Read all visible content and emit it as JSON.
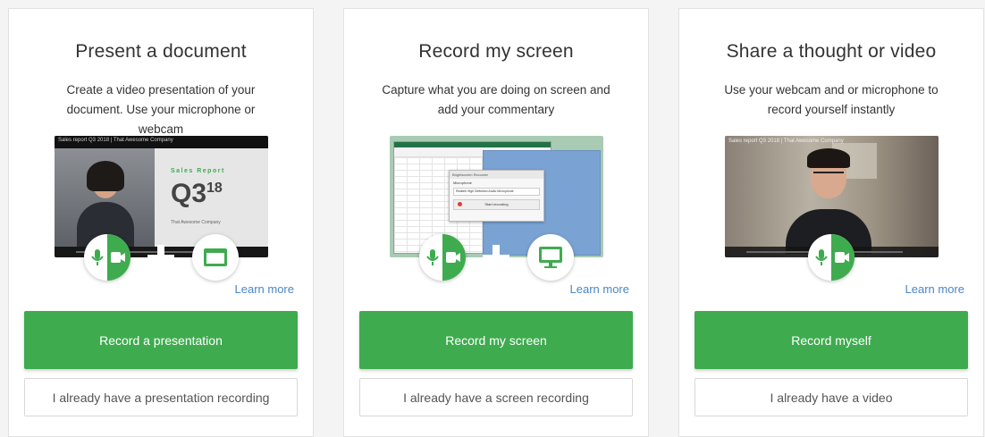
{
  "cards": [
    {
      "title": "Present a document",
      "description": "Create a video presentation of your document. Use your microphone or webcam",
      "thumbnail_caption": "Sales report Q3 2018 | That Awesome Company",
      "slide_heading": "Sales Report",
      "slide_big": "Q3",
      "slide_sup": "18",
      "slide_company": "That Awesome Company",
      "learn_more": "Learn more",
      "primary_button": "Record a presentation",
      "secondary_button": "I already have a presentation recording"
    },
    {
      "title": "Record my screen",
      "description": "Capture what you are doing on screen and add your commentary",
      "dialog_title": "Brightscreen Recorder",
      "dialog_mic_label": "Microphone",
      "dialog_select": "Realtek High Definition Audio Microphone",
      "dialog_button": "Start recording",
      "learn_more": "Learn more",
      "primary_button": "Record my screen",
      "secondary_button": "I already have a screen recording"
    },
    {
      "title": "Share a thought or video",
      "description": "Use your webcam and or microphone to record yourself instantly",
      "thumbnail_caption": "Sales report Q3 2018 | That Awesome Company",
      "learn_more": "Learn more",
      "primary_button": "Record myself",
      "secondary_button": "I already have a video"
    }
  ],
  "colors": {
    "accent_green": "#3fab4f",
    "link_blue": "#4a86c8"
  },
  "icons": [
    "microphone-icon",
    "video-camera-icon",
    "plus-icon",
    "window-icon",
    "monitor-icon"
  ]
}
